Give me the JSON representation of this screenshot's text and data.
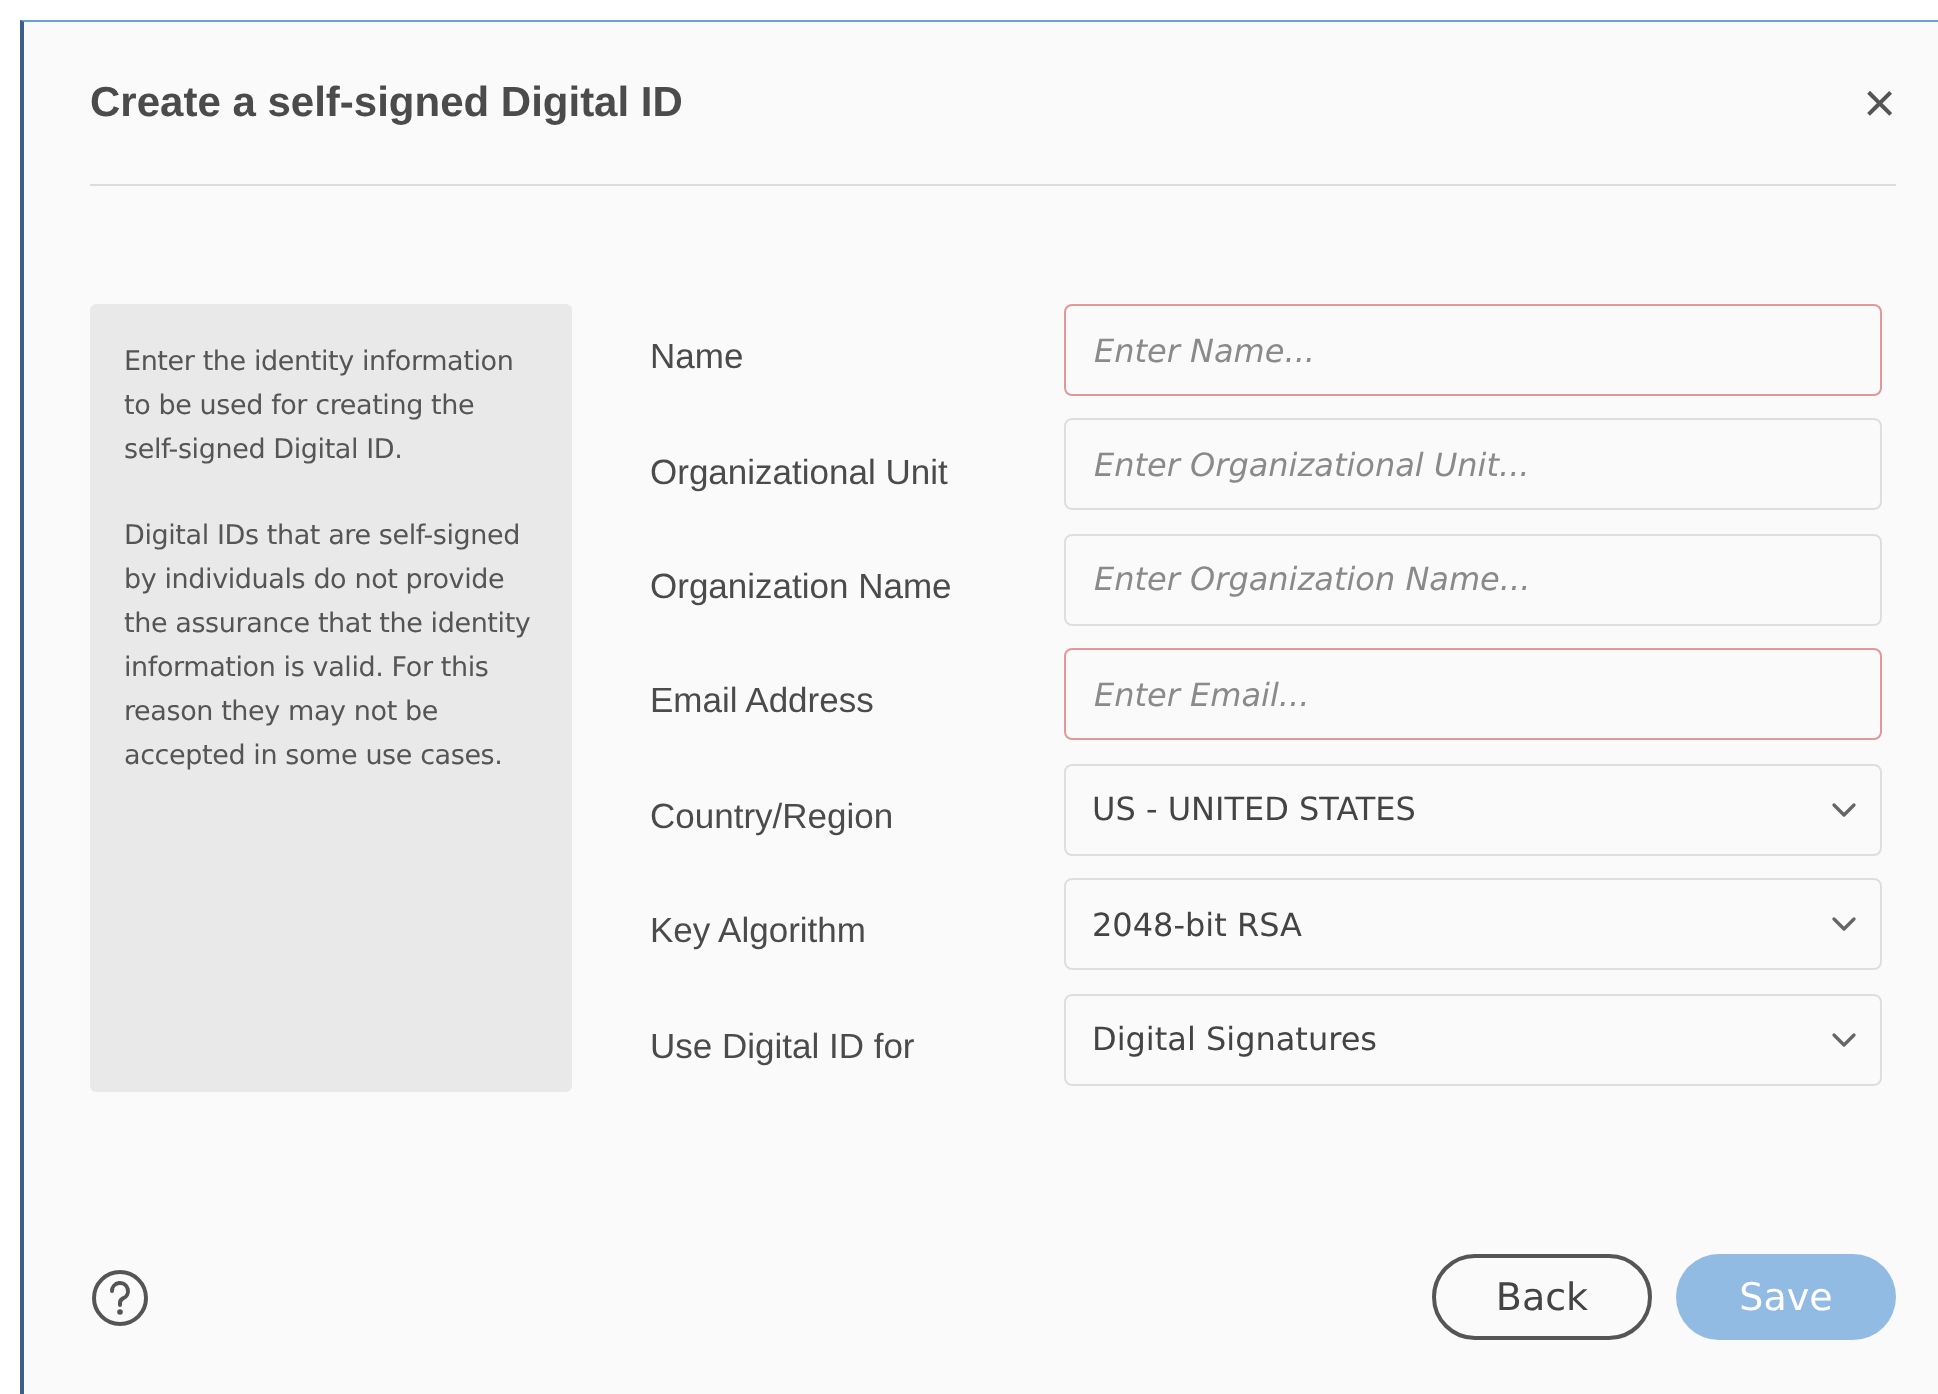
{
  "dialog": {
    "title": "Create a self-signed Digital ID",
    "close": "×"
  },
  "info": {
    "paragraphs": [
      "Enter the identity information to be used for creating the self-signed Digital ID.",
      "Digital IDs that are self-signed by individuals do not provide the assurance that the identity information is valid. For this reason they may not be accepted in some use cases."
    ]
  },
  "fields": [
    {
      "kind": "text",
      "label": "Name",
      "placeholder": "Enter Name...",
      "invalid": true
    },
    {
      "kind": "text",
      "label": "Organizational Unit",
      "placeholder": "Enter Organizational Unit...",
      "invalid": false
    },
    {
      "kind": "text",
      "label": "Organization Name",
      "placeholder": "Enter Organization Name...",
      "invalid": false
    },
    {
      "kind": "text",
      "label": "Email Address",
      "placeholder": "Enter Email...",
      "invalid": true
    },
    {
      "kind": "select",
      "label": "Country/Region",
      "value": "US - UNITED STATES"
    },
    {
      "kind": "select",
      "label": "Key Algorithm",
      "value": "2048-bit RSA"
    },
    {
      "kind": "select",
      "label": "Use Digital ID for",
      "value": "Digital Signatures"
    }
  ],
  "buttons": [
    {
      "label": "Back",
      "kind": "secondary",
      "disabled": false
    },
    {
      "label": "Save",
      "kind": "primary",
      "disabled": true
    }
  ]
}
